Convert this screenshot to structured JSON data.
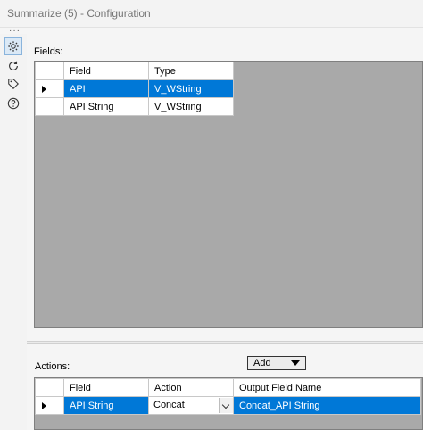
{
  "window": {
    "title": "Summarize (5) - Configuration",
    "more": "···"
  },
  "sidebar": {
    "icons": [
      {
        "name": "gear-icon",
        "active": true
      },
      {
        "name": "refresh-icon",
        "active": false
      },
      {
        "name": "tag-icon",
        "active": false
      },
      {
        "name": "help-icon",
        "active": false
      }
    ]
  },
  "fields": {
    "label": "Fields:",
    "columns": [
      "Field",
      "Type"
    ],
    "rows": [
      {
        "field": "API",
        "type": "V_WString",
        "selected": true
      },
      {
        "field": "API String",
        "type": "V_WString",
        "selected": false
      }
    ]
  },
  "actions": {
    "label": "Actions:",
    "add_label": "Add",
    "columns": [
      "Field",
      "Action",
      "Output Field Name"
    ],
    "rows": [
      {
        "field": "API String",
        "action": "Concat",
        "output": "Concat_API String",
        "selected": true
      }
    ]
  }
}
